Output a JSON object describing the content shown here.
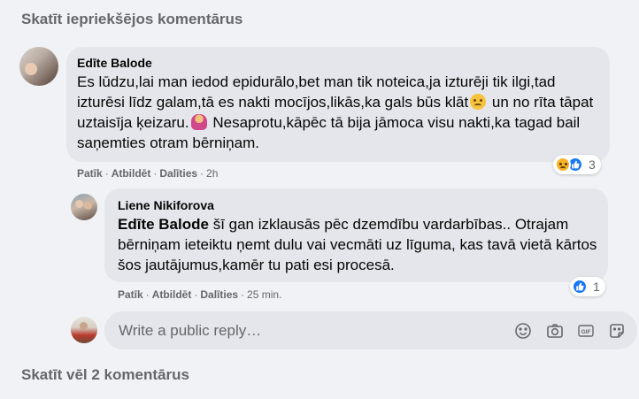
{
  "view_previous_label": "Skatīt iepriekšējos komentārus",
  "view_more_label": "Skatīt vēl 2 komentārus",
  "comment1": {
    "author": "Edīte Balode",
    "text_part1": "Es lūdzu,lai man iedod epidurālo,bet man tik noteica,ja izturēji tik ilgi,tad izturēsi līdz galam,tā es nakti mocījos,likās,ka gals būs klāt",
    "text_part2": " un no rīta tāpat uztaisīja ķeizaru.",
    "text_part3": " Nesaprotu,kāpēc tā bija jāmoca visu nakti,ka tagad bail saņemties otram bērniņam.",
    "emoji1": "sad-face-emoji",
    "emoji2": "woman-shrugging-emoji",
    "like_label": "Patīk",
    "reply_label": "Atbildēt",
    "share_label": "Dalīties",
    "timestamp": "2h",
    "reaction_count": "3"
  },
  "comment2": {
    "author": "Liene Nikiforova",
    "mention": "Edīte Balode",
    "text": " šī gan izklausās pēc dzemdību vardarbības.. Otrajam bērniņam ieteiktu ņemt dulu vai vecmāti uz līguma, kas tavā vietā kārtos šos jautājumus,kamēr tu pati esi procesā.",
    "like_label": "Patīk",
    "reply_label": "Atbildēt",
    "share_label": "Dalīties",
    "timestamp": "25 min.",
    "reaction_count": "1"
  },
  "reply_box": {
    "placeholder": "Write a public reply…",
    "icons": [
      "emoji-icon",
      "camera-icon",
      "gif-icon",
      "sticker-icon"
    ]
  },
  "colors": {
    "background": "#f0f2f5",
    "bubble": "#e4e6eb",
    "secondary_text": "#65676b",
    "like_blue": "#1877f2"
  }
}
